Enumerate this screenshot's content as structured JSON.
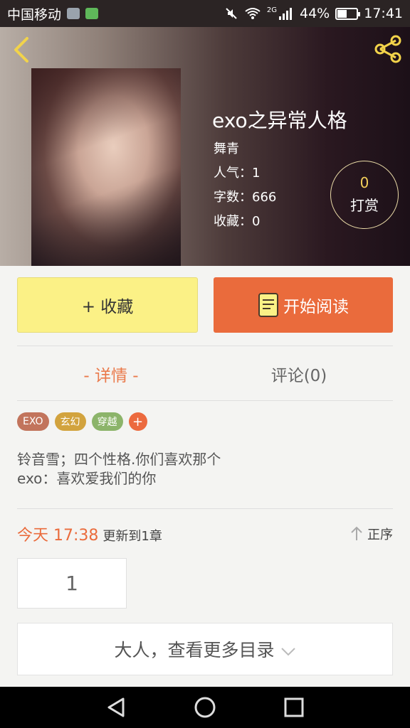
{
  "status_bar": {
    "carrier": "中国移动",
    "signal_label": "2G",
    "battery": "44%",
    "battery_level": 0.44,
    "time": "17:41"
  },
  "book": {
    "title": "exo之异常人格",
    "author": "舞青",
    "popularity": "人气：1",
    "word_count": "字数：666",
    "favorites": "收藏：0"
  },
  "reward": {
    "count": "0",
    "label": "打赏"
  },
  "actions": {
    "favorite_label": "+ 收藏",
    "read_label": "开始阅读"
  },
  "tabs": [
    {
      "label": "- 详情 -"
    },
    {
      "label": "评论(0)"
    }
  ],
  "tags": [
    {
      "label": "EXO"
    },
    {
      "label": "玄幻"
    },
    {
      "label": "穿越"
    }
  ],
  "add_tag_label": "+",
  "summary": [
    "铃音雪；四个性格.你们喜欢那个",
    "exo：喜欢爱我们的你"
  ],
  "update": {
    "time": "今天 17:38",
    "text": "更新到1章"
  },
  "sort_label": "正序",
  "chapters": [
    "1"
  ],
  "more_catalog_label": "大人，查看更多目录",
  "colors": {
    "accent": "#ea6b3c",
    "favorite_bg": "#fbf186",
    "reward_num": "#f3cf5a"
  }
}
